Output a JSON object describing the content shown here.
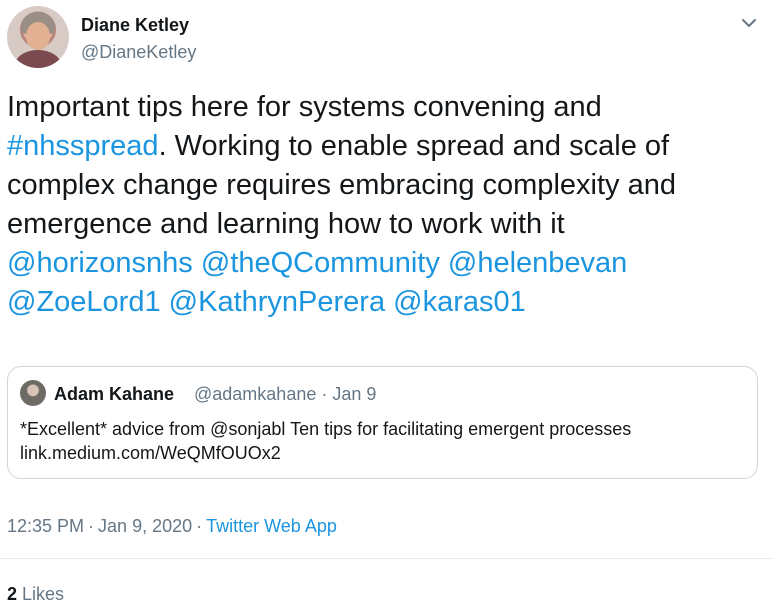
{
  "author": {
    "name": "Diane Ketley",
    "handle": "@DianeKetley"
  },
  "tweet": {
    "text_1": "Important tips here for systems convening and ",
    "hashtag": "#nhsspread",
    "text_2": ". Working to enable spread and scale of complex change requires embracing complexity and emergence and learning how to work with it ",
    "mentions": [
      "@horizonsnhs",
      "@theQCommunity",
      "@helenbevan",
      "@ZoeLord1",
      "@KathrynPerera",
      "@karas01"
    ]
  },
  "quoted": {
    "name": "Adam Kahane",
    "handle": "@adamkahane",
    "date": "Jan 9",
    "line_1": "*Excellent* advice from @sonjabl Ten tips for facilitating emergent processes",
    "line_2": "link.medium.com/WeQMfOUOx2"
  },
  "meta": {
    "time": "12:35 PM",
    "date": "Jan 9, 2020",
    "app": "Twitter Web App",
    "likes_count": "2",
    "likes_label": "Likes"
  },
  "colors": {
    "link": "#1b95e0",
    "secondary_text": "#657786",
    "border": "#ccd6dd"
  },
  "icons": {
    "caret": "chevron-down-icon"
  }
}
